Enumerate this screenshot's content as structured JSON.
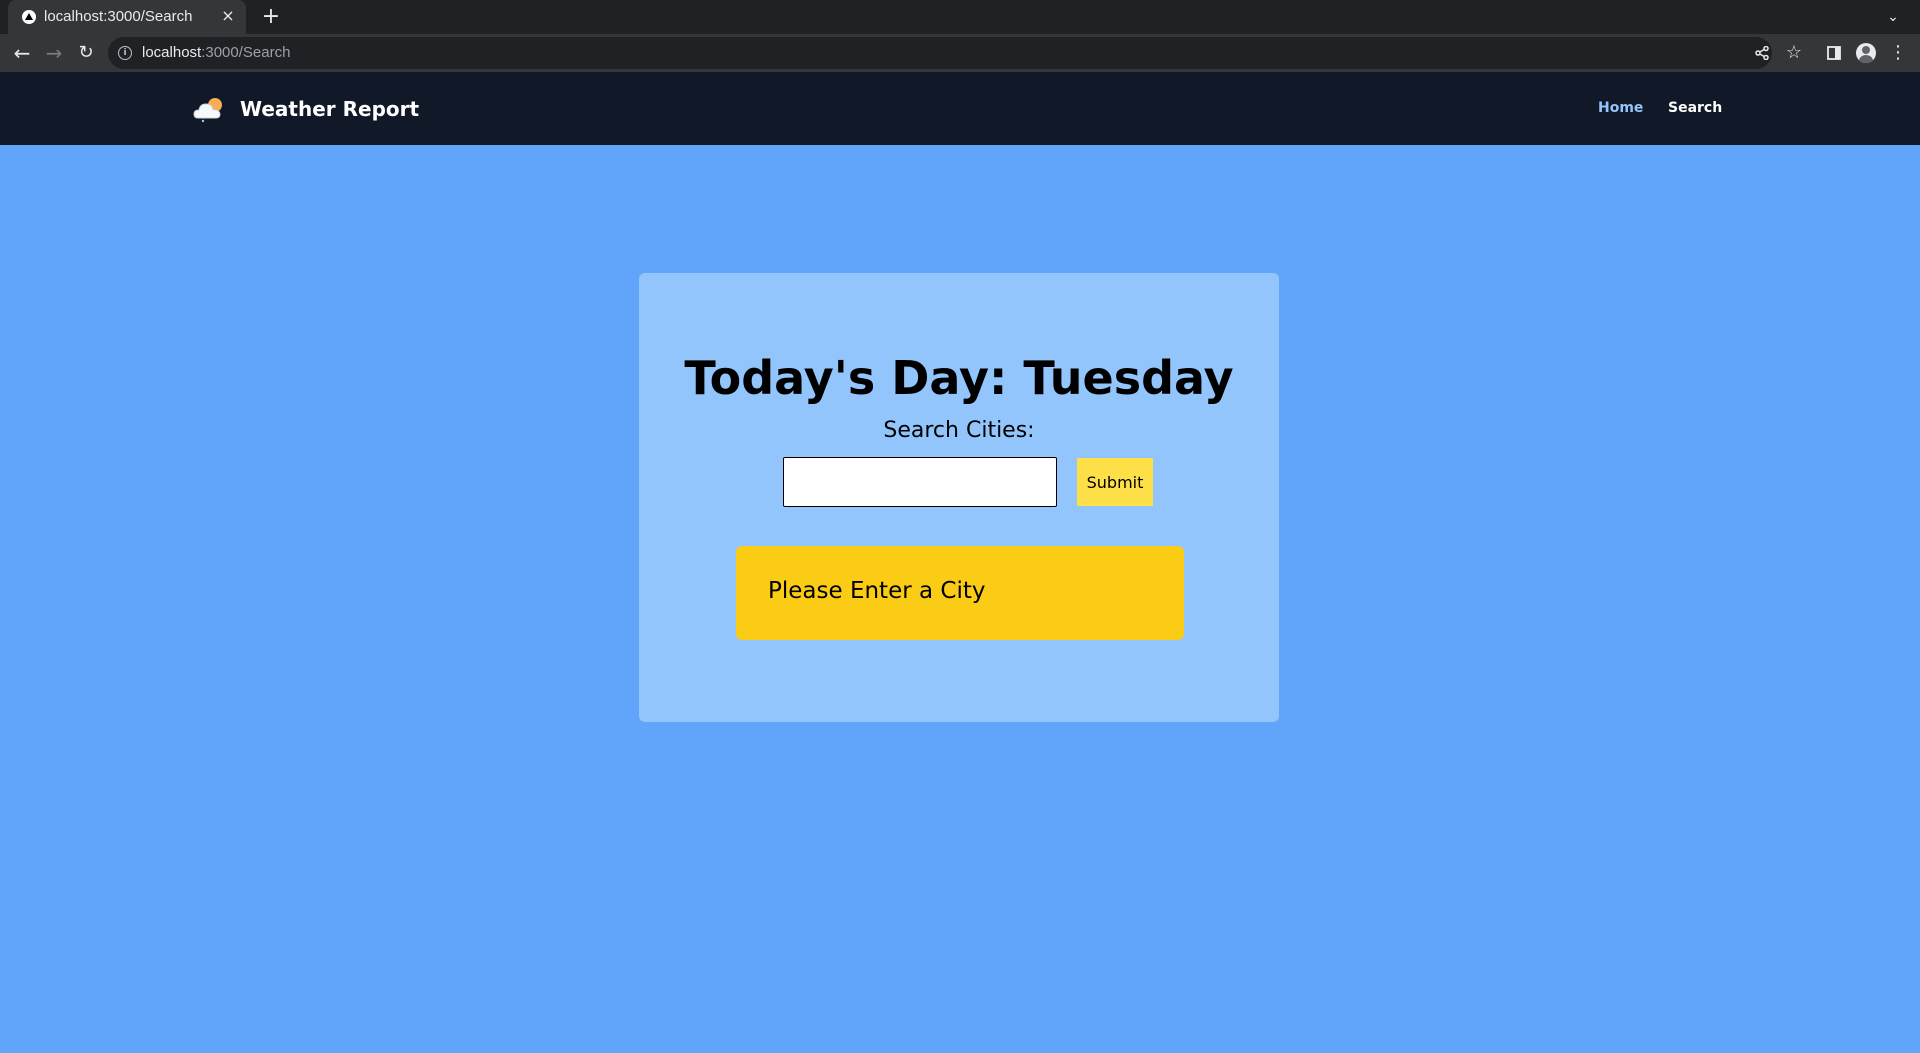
{
  "browser": {
    "tab_title": "localhost:3000/Search",
    "tab_close": "×",
    "new_tab": "+",
    "url_host": "localhost",
    "url_rest": ":3000/Search",
    "icons": [
      "back-icon",
      "forward-icon",
      "reload-icon",
      "info-icon",
      "share-icon",
      "star-icon",
      "side-panel-icon",
      "profile-icon",
      "menu-icon"
    ]
  },
  "site": {
    "brand": "Weather Report",
    "nav": {
      "home": "Home",
      "search": "Search"
    },
    "colors": {
      "navbar": "#111827",
      "background": "#60a5fa",
      "card": "#93c5fd",
      "active_link": "#93c5fd",
      "submit": "#fde047",
      "message": "#facc15"
    }
  },
  "main": {
    "heading": "Today's Day: Tuesday",
    "search_label": "Search Cities:",
    "input_value": "",
    "input_placeholder": "",
    "submit_label": "Submit",
    "message": "Please Enter a City"
  }
}
